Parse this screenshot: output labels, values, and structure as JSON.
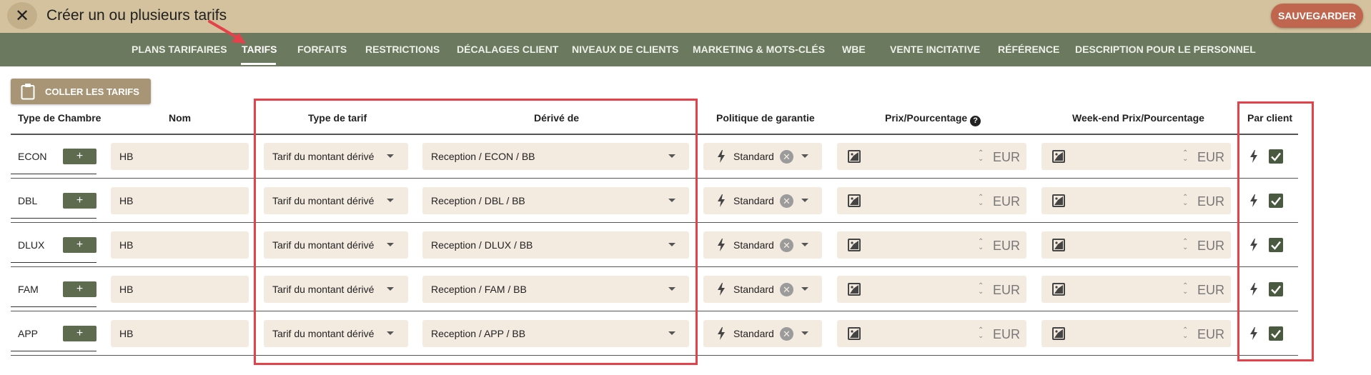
{
  "header": {
    "title": "Créer un ou plusieurs tarifs",
    "save_label": "SAUVEGARDER",
    "close_icon": "close-icon"
  },
  "nav": {
    "tabs": [
      {
        "label": "PLANS TARIFAIRES",
        "active": false
      },
      {
        "label": "TARIFS",
        "active": true
      },
      {
        "label": "FORFAITS",
        "active": false
      },
      {
        "label": "RESTRICTIONS",
        "active": false
      },
      {
        "label": "DÉCALAGES CLIENT",
        "active": false
      },
      {
        "label": "NIVEAUX DE CLIENTS",
        "active": false
      },
      {
        "label": "MARKETING & MOTS-CLÉS",
        "active": false
      },
      {
        "label": "WBE",
        "active": false
      },
      {
        "label": "VENTE INCITATIVE",
        "active": false
      },
      {
        "label": "RÉFÉRENCE",
        "active": false
      },
      {
        "label": "DESCRIPTION POUR LE PERSONNEL",
        "active": false
      }
    ]
  },
  "toolbar": {
    "paste_label": "COLLER LES TARIFS",
    "paste_icon": "clipboard-icon"
  },
  "table": {
    "headers": {
      "room_type": "Type de Chambre",
      "name": "Nom",
      "rate_type": "Type de tarif",
      "derived_from": "Dérivé de",
      "guarantee": "Politique de garantie",
      "price": "Prix/Pourcentage",
      "price_help": "?",
      "weekend_price": "Week-end Prix/Pourcentage",
      "per_client": "Par client"
    },
    "add_label": "+",
    "rows": [
      {
        "room": "ECON",
        "name": "HB",
        "rate_type": "Tarif du montant dérivé",
        "derived": "Reception / ECON / BB",
        "guarantee": "Standard",
        "currency": "EUR",
        "weekend_currency": "EUR",
        "per_client": true
      },
      {
        "room": "DBL",
        "name": "HB",
        "rate_type": "Tarif du montant dérivé",
        "derived": "Reception / DBL / BB",
        "guarantee": "Standard",
        "currency": "EUR",
        "weekend_currency": "EUR",
        "per_client": true
      },
      {
        "room": "DLUX",
        "name": "HB",
        "rate_type": "Tarif du montant dérivé",
        "derived": "Reception / DLUX / BB",
        "guarantee": "Standard",
        "currency": "EUR",
        "weekend_currency": "EUR",
        "per_client": true
      },
      {
        "room": "FAM",
        "name": "HB",
        "rate_type": "Tarif du montant dérivé",
        "derived": "Reception / FAM / BB",
        "guarantee": "Standard",
        "currency": "EUR",
        "weekend_currency": "EUR",
        "per_client": true
      },
      {
        "room": "APP",
        "name": "HB",
        "rate_type": "Tarif du montant dérivé",
        "derived": "Reception / APP / BB",
        "guarantee": "Standard",
        "currency": "EUR",
        "weekend_currency": "EUR",
        "per_client": true
      }
    ]
  },
  "colors": {
    "topbar": "#d3c29d",
    "navbar": "#6b7a5e",
    "save_button": "#c0664f",
    "field_bg": "#f4ebe0",
    "highlight_box": "#e4414a"
  }
}
